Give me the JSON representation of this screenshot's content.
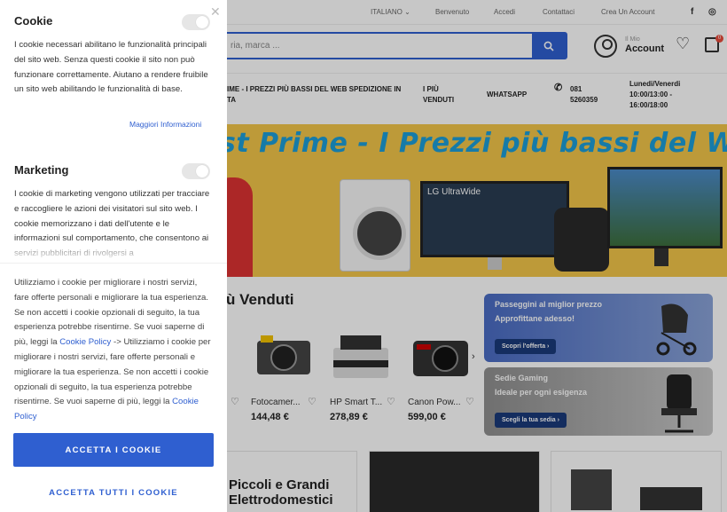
{
  "topbar": {
    "language": "ITALIANO",
    "links": [
      "Benvenuto",
      "Accedi",
      "Contattaci",
      "Crea Un Account"
    ]
  },
  "header": {
    "search_placeholder": "ria, marca ...",
    "account_small": "Il Mio",
    "account_label": "Account",
    "cart_count": "0"
  },
  "navbar": {
    "promo_line1": "IME - I PREZZI PIÙ BASSI DEL WEB SPEDIZIONE IN",
    "promo_line2": "TA",
    "piu_line1": "I PIÙ",
    "piu_line2": "VENDUTI",
    "whatsapp": "WHATSAPP",
    "phone_line1": "081",
    "phone_line2": "5260359",
    "hours_line1": "Lunedi/Venerdi",
    "hours_line2": "10:00/13:00 -",
    "hours_line3": "16:00/18:00"
  },
  "banner": {
    "title": "st Prime - I Prezzi più bassi del Web",
    "monitor_label": "LG UltraWide"
  },
  "bestsellers": {
    "title": "ù Venduti",
    "products": [
      {
        "name": "Fotocamer...",
        "price": "144,48 €"
      },
      {
        "name": "HP Smart T...",
        "price": "278,89 €"
      },
      {
        "name": "Canon Pow...",
        "price": "599,00 €"
      }
    ]
  },
  "promos": [
    {
      "line1": "Passeggini al miglior prezzo",
      "line2": "Approfittane adesso!",
      "cta": "Scopri l'offerta ›"
    },
    {
      "line1": "Sedie Gaming",
      "line2": "Ideale per ogni esigenza",
      "cta": "Scegli la tua sedia ›"
    }
  ],
  "bottom": {
    "title_line1": "Piccoli e Grandi",
    "title_line2": "Elettrodomestici"
  },
  "cookie_panel": {
    "section1_title": "Cookie",
    "section1_text": "I cookie necessari abilitano le funzionalità principali del sito web. Senza questi cookie il sito non può funzionare correttamente. Aiutano a rendere fruibile un sito web abilitando le funzionalità di base.",
    "more_info": "Maggiori Informazioni",
    "section2_title": "Marketing",
    "section2_text": "I cookie di marketing vengono utilizzati per tracciare e raccogliere le azioni dei visitatori sul sito web. I cookie memorizzano i dati dell'utente e le informazioni sul comportamento, che consentono ai servizi pubblicitari di rivolgersi a",
    "consent_text1": "Utilizziamo i cookie per migliorare i nostri servizi, fare offerte personali e migliorare la tua esperienza. Se non accetti i cookie opzionali di seguito, la tua esperienza potrebbe risentirne. Se vuoi saperne di più, leggi la ",
    "consent_link1": "Cookie Policy",
    "consent_text2": " -> Utilizziamo i cookie per migliorare i nostri servizi, fare offerte personali e migliorare la tua esperienza. Se non accetti i cookie opzionali di seguito, la tua esperienza potrebbe risentirne. Se vuoi saperne di più, leggi la ",
    "consent_link2": "Cookie Policy",
    "accept_button": "ACCETTA I COOKIE",
    "accept_all_button": "ACCETTA TUTTI I COOKIE"
  }
}
